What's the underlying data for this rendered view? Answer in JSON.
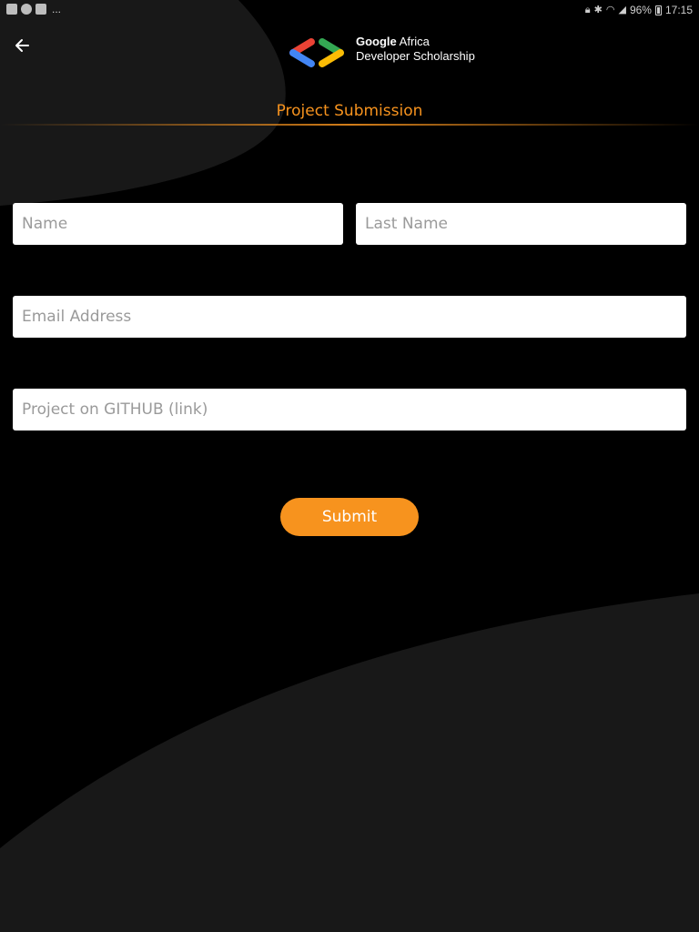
{
  "status_bar": {
    "left_icons": [
      "gallery-icon",
      "photos-icon",
      "message-icon"
    ],
    "overflow": "...",
    "right_icons": [
      "lock-icon",
      "bluetooth-icon",
      "wifi-icon",
      "signal-icon",
      "battery-icon"
    ],
    "battery_text": "96%",
    "time": "17:15"
  },
  "header": {
    "back_icon": "arrow-back-icon",
    "logo": {
      "brand": "Google",
      "line1_rest": " Africa",
      "line2": "Developer Scholarship"
    }
  },
  "page": {
    "title": "Project Submission"
  },
  "form": {
    "name_placeholder": "Name",
    "last_name_placeholder": "Last Name",
    "email_placeholder": "Email Address",
    "github_placeholder": "Project on GITHUB (link)",
    "name_value": "",
    "last_name_value": "",
    "email_value": "",
    "github_value": ""
  },
  "submit": {
    "label": "Submit"
  },
  "colors": {
    "background": "#000000",
    "background_shape": "#181818",
    "accent": "#f7931e",
    "field_background": "#ffffff",
    "placeholder": "#9a9a9a"
  }
}
